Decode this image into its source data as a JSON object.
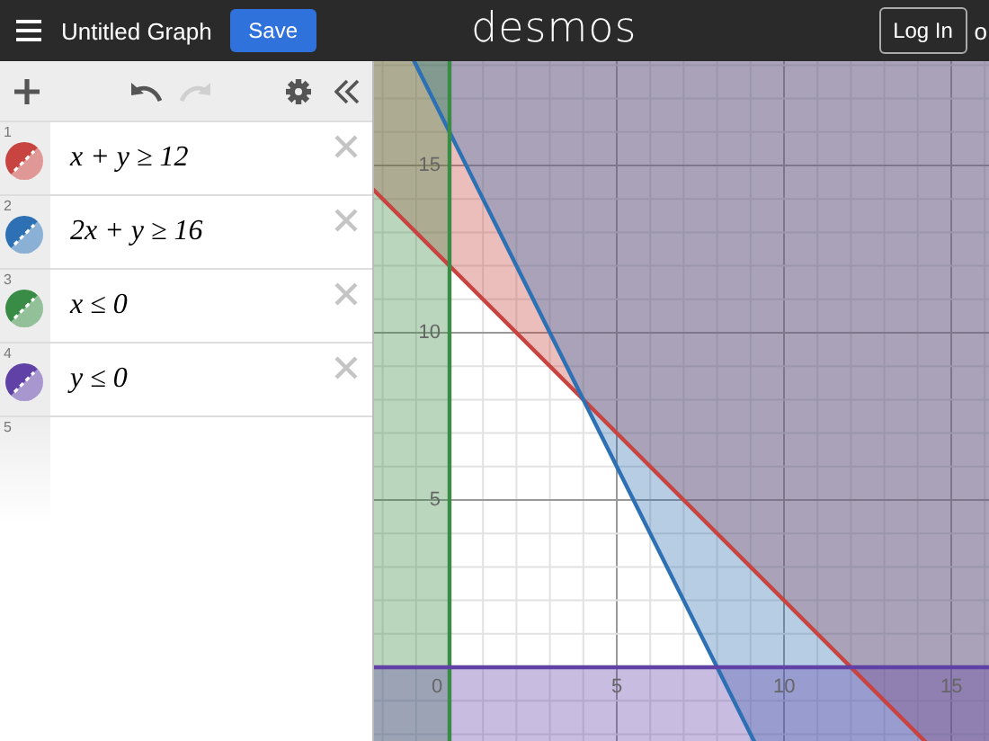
{
  "header": {
    "title": "Untitled Graph",
    "save_button": "Save",
    "logo": "desmos",
    "login_button": "Log In",
    "trailing_text": "o"
  },
  "toolbar": {
    "undo_disabled": false,
    "redo_disabled": true
  },
  "expressions": [
    {
      "kind": "inequality",
      "number": "1",
      "latex": "x + y ≥ 12",
      "color": "#c74440"
    },
    {
      "kind": "inequality",
      "number": "2",
      "latex": "2x + y ≥ 16",
      "color": "#2d70b3"
    },
    {
      "kind": "inequality",
      "number": "3",
      "latex": "x ≤ 0",
      "color": "#388c46"
    },
    {
      "kind": "inequality",
      "number": "4",
      "latex": "y ≤ 0",
      "color": "#6042a6"
    },
    {
      "kind": "empty",
      "number": "5"
    }
  ],
  "graph": {
    "x_tick_labels": [
      "0",
      "5",
      "10",
      "15"
    ],
    "y_tick_labels": [
      "15",
      "10",
      "5"
    ]
  }
}
